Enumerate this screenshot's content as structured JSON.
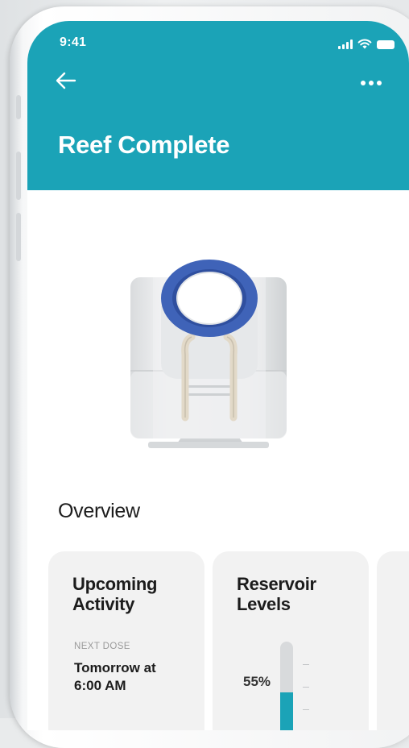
{
  "status_bar": {
    "time": "9:41"
  },
  "header": {
    "title": "Reef Complete"
  },
  "overview": {
    "title": "Overview"
  },
  "cards": {
    "upcoming": {
      "title_line1": "Upcoming",
      "title_line2": "Activity",
      "next_dose_label": "NEXT DOSE",
      "next_dose_line1": "Tomorrow at",
      "next_dose_line2": "6:00 AM"
    },
    "reservoir": {
      "title_line1": "Reservoir",
      "title_line2": "Levels",
      "percent_text": "55%",
      "level": 0.55
    }
  },
  "icons": {
    "back": "arrow-left",
    "more": "ellipsis-horizontal",
    "signal": "cellular-signal",
    "wifi": "wifi",
    "battery": "battery-full"
  },
  "colors": {
    "accent": "#1ba3b7",
    "device_ring": "#3f63b8"
  }
}
